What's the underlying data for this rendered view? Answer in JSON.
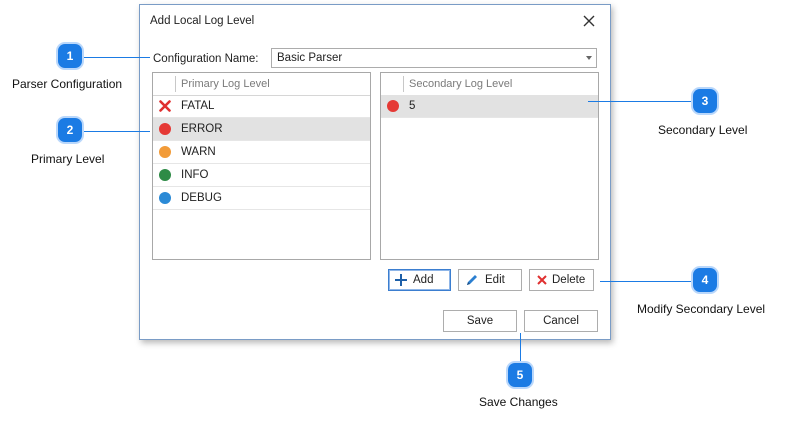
{
  "dialog": {
    "title": "Add Local Log Level",
    "config_label": "Configuration Name:",
    "config_value": "Basic Parser",
    "primary_header": "Primary Log Level",
    "secondary_header": "Secondary Log Level",
    "primary_levels": [
      {
        "label": "FATAL",
        "icon": "x-icon",
        "color": "#e03030"
      },
      {
        "label": "ERROR",
        "icon": "circle-icon",
        "color": "#e53935",
        "selected": true
      },
      {
        "label": "WARN",
        "icon": "circle-icon",
        "color": "#f29b38"
      },
      {
        "label": "INFO",
        "icon": "circle-icon",
        "color": "#2e8b46"
      },
      {
        "label": "DEBUG",
        "icon": "circle-icon",
        "color": "#2b8ad6"
      }
    ],
    "secondary_levels": [
      {
        "label": "5",
        "icon": "circle-icon",
        "color": "#e53935",
        "selected": true
      }
    ],
    "buttons": {
      "add": "Add",
      "edit": "Edit",
      "delete": "Delete",
      "save": "Save",
      "cancel": "Cancel"
    }
  },
  "callouts": [
    {
      "number": "1",
      "label": "Parser Configuration"
    },
    {
      "number": "2",
      "label": "Primary Level"
    },
    {
      "number": "3",
      "label": "Secondary Level"
    },
    {
      "number": "4",
      "label": "Modify Secondary Level"
    },
    {
      "number": "5",
      "label": "Save Changes"
    }
  ],
  "colors": {
    "accent": "#1b7be4",
    "dialog_border": "#7a9cc6"
  }
}
